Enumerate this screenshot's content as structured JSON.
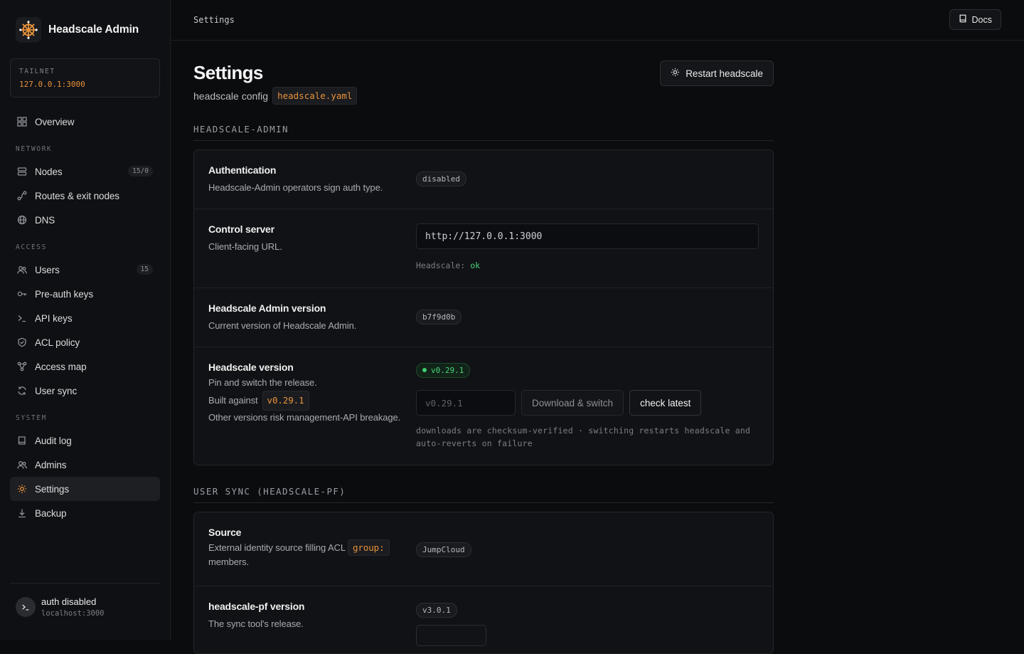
{
  "app": {
    "title": "Headscale Admin"
  },
  "tailnet": {
    "label": "TAILNET",
    "value": "127.0.0.1:3000"
  },
  "sidebar": {
    "overview": "Overview",
    "sections": {
      "network": "NETWORK",
      "access": "ACCESS",
      "system": "SYSTEM"
    },
    "items": {
      "nodes": {
        "label": "Nodes",
        "badge": "15/0"
      },
      "routes": {
        "label": "Routes & exit nodes"
      },
      "dns": {
        "label": "DNS"
      },
      "users": {
        "label": "Users",
        "badge": "15"
      },
      "preauth": {
        "label": "Pre-auth keys"
      },
      "apikeys": {
        "label": "API keys"
      },
      "acl": {
        "label": "ACL policy"
      },
      "accessmap": {
        "label": "Access map"
      },
      "usersync": {
        "label": "User sync"
      },
      "audit": {
        "label": "Audit log"
      },
      "admins": {
        "label": "Admins"
      },
      "settings": {
        "label": "Settings"
      },
      "backup": {
        "label": "Backup"
      }
    },
    "footer": {
      "name": "auth disabled",
      "host": "localhost:3000"
    }
  },
  "topbar": {
    "breadcrumb": "Settings",
    "docs_label": "Docs"
  },
  "page": {
    "title": "Settings",
    "subtitle": "headscale config",
    "config_file": "headscale.yaml",
    "restart_label": "Restart headscale"
  },
  "sections": {
    "admin": {
      "title": "HEADSCALE-ADMIN",
      "auth": {
        "title": "Authentication",
        "desc": "Headscale-Admin operators sign auth type.",
        "value": "disabled"
      },
      "control": {
        "title": "Control server",
        "desc": "Client-facing URL.",
        "value": "http://127.0.0.1:3000",
        "status_label": "Headscale:",
        "status_value": "ok"
      },
      "admin_version": {
        "title": "Headscale Admin version",
        "desc": "Current version of Headscale Admin.",
        "value": "b7f9d0b"
      },
      "hs_version": {
        "title": "Headscale version",
        "desc1": "Pin and switch the release.",
        "built_prefix": "Built against",
        "built_value": "v0.29.1",
        "desc2": "Other versions risk management-API breakage.",
        "current": "v0.29.1",
        "input_placeholder": "v0.29.1",
        "download_label": "Download & switch",
        "check_label": "check latest",
        "note": "downloads are checksum-verified · switching restarts headscale and auto-reverts on failure"
      }
    },
    "sync": {
      "title": "USER SYNC (HEADSCALE-PF)",
      "source": {
        "title": "Source",
        "desc_prefix": "External identity source filling ACL",
        "desc_chip": "group:",
        "desc_suffix": "members.",
        "value": "JumpCloud"
      },
      "pf_version": {
        "title": "headscale-pf version",
        "desc": "The sync tool's release.",
        "value": "v3.0.1"
      }
    }
  },
  "colors": {
    "accent": "#e8923a",
    "ok": "#4bd37a",
    "bg": "#0b0c0e"
  }
}
